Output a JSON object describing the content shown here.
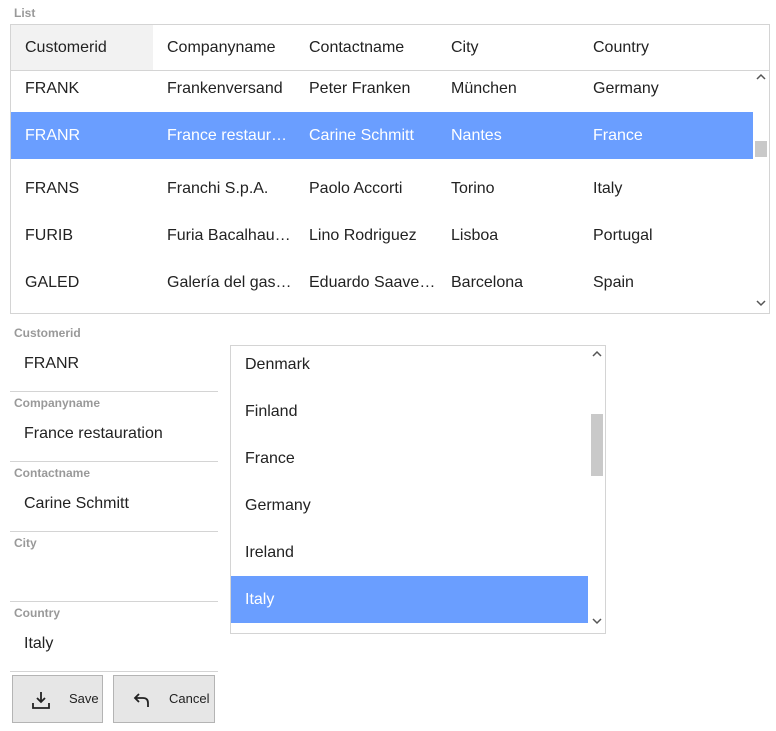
{
  "list_label": "List",
  "grid": {
    "columns": [
      "Customerid",
      "Companyname",
      "Contactname",
      "City",
      "Country"
    ],
    "rows": [
      {
        "Customerid": "FRANK",
        "Companyname": "Frankenversand",
        "Contactname": "Peter Franken",
        "City": "München",
        "Country": "Germany"
      },
      {
        "Customerid": "FRANR",
        "Companyname": "France restauration",
        "Contactname": "Carine Schmitt",
        "City": "Nantes",
        "Country": "France"
      },
      {
        "Customerid": "FRANS",
        "Companyname": "Franchi S.p.A.",
        "Contactname": "Paolo Accorti",
        "City": "Torino",
        "Country": "Italy"
      },
      {
        "Customerid": "FURIB",
        "Companyname": "Furia Bacalhau e …",
        "Contactname": "Lino Rodriguez",
        "City": "Lisboa",
        "Country": "Portugal"
      },
      {
        "Customerid": "GALED",
        "Companyname": "Galería del gastró…",
        "Contactname": "Eduardo Saavedra",
        "City": "Barcelona",
        "Country": "Spain"
      }
    ],
    "selected_row_index": 1
  },
  "form": {
    "customerid_label": "Customerid",
    "customerid_value": "FRANR",
    "companyname_label": "Companyname",
    "companyname_value": "France restauration",
    "contactname_label": "Contactname",
    "contactname_value": "Carine Schmitt",
    "city_label": "City",
    "city_value": "",
    "country_label": "Country",
    "country_value": "Italy"
  },
  "country_list": {
    "items": [
      "Denmark",
      "Finland",
      "France",
      "Germany",
      "Ireland",
      "Italy"
    ],
    "selected_index": 5
  },
  "buttons": {
    "save_label": "Save",
    "cancel_label": "Cancel"
  },
  "colors": {
    "selection": "#6a9eff",
    "border": "#d4d4d4",
    "label_gray": "#999999",
    "button_bg": "#e6e6e6"
  },
  "icons": {
    "save": "save-download-icon",
    "cancel": "undo-arrow-icon",
    "scroll_up": "chevron-up-icon",
    "scroll_down": "chevron-down-icon"
  }
}
